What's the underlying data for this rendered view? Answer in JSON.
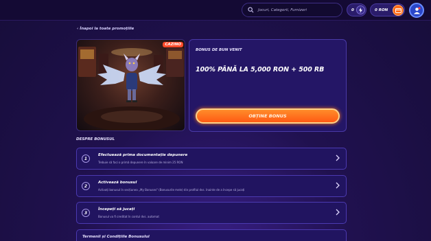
{
  "header": {
    "search_placeholder": "Jocuri, Categorii, Furnizori",
    "balance_1": "0",
    "balance_2": "0 RON"
  },
  "breadcrumb": {
    "back_label": "Înapoi la toate promoțiile"
  },
  "hero": {
    "badge": "CAZINO"
  },
  "offer": {
    "kicker": "BONUS DE BUN VENIT",
    "headline": "100% PÂNĂ LA 5,000 RON + 500 RB",
    "cta_label": "OBȚINE BONUS"
  },
  "steps_section": {
    "title": "DESPRE BONUSUL",
    "steps": [
      {
        "num": "1",
        "title": "Efectuează prima documentație depunere",
        "desc": "Trebuie să faci o primă depunere în valoare de minim 25 RON"
      },
      {
        "num": "2",
        "title": "Activează bonusul",
        "desc": "Activați bonusul în secțiunea „My Bonuses\" (Bonusurile mele) din profilul dvs. înainte de a începe să jucați"
      },
      {
        "num": "3",
        "title": "Începeți să jucați",
        "desc": "Bonusul va fi creditat în contul dvs. automat"
      }
    ]
  },
  "terms": {
    "title": "Termenii și Condițiile Bonusului"
  },
  "colors": {
    "accent": "#ff6a1a",
    "panel": "#211460",
    "border": "#4c3ab2"
  }
}
